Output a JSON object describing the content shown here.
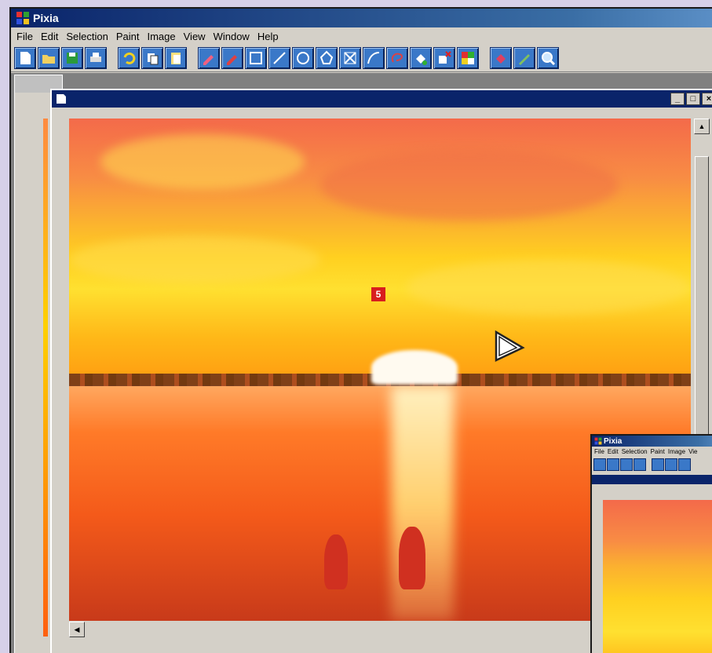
{
  "app": {
    "title": "Pixia"
  },
  "menu": {
    "items": [
      {
        "label": "File"
      },
      {
        "label": "Edit"
      },
      {
        "label": "Selection"
      },
      {
        "label": "Paint"
      },
      {
        "label": "Image"
      },
      {
        "label": "View"
      },
      {
        "label": "Window"
      },
      {
        "label": "Help"
      }
    ]
  },
  "toolbar": {
    "icons": [
      "new-icon",
      "open-icon",
      "save-icon",
      "print-icon",
      "undo-icon",
      "copy-icon",
      "paste-icon",
      "pen-icon",
      "eraser-icon",
      "rectangle-icon",
      "line-icon",
      "ellipse-icon",
      "polygon-icon",
      "cross-icon",
      "curve-icon",
      "lasso-icon",
      "bucket-icon",
      "delete-icon",
      "mosaic-icon",
      "fill-icon",
      "pencil-icon",
      "zoom-icon"
    ]
  },
  "document": {
    "badge": "5",
    "window_buttons": {
      "minimize": "_",
      "maximize": "□",
      "close": "×"
    }
  },
  "inset": {
    "title": "Pixia",
    "menu": [
      "File",
      "Edit",
      "Selection",
      "Paint",
      "Image",
      "Vie"
    ]
  },
  "colors": {
    "titlebar": "#0a246a",
    "accent": "#3a78c8",
    "badge": "#d81e1e"
  }
}
